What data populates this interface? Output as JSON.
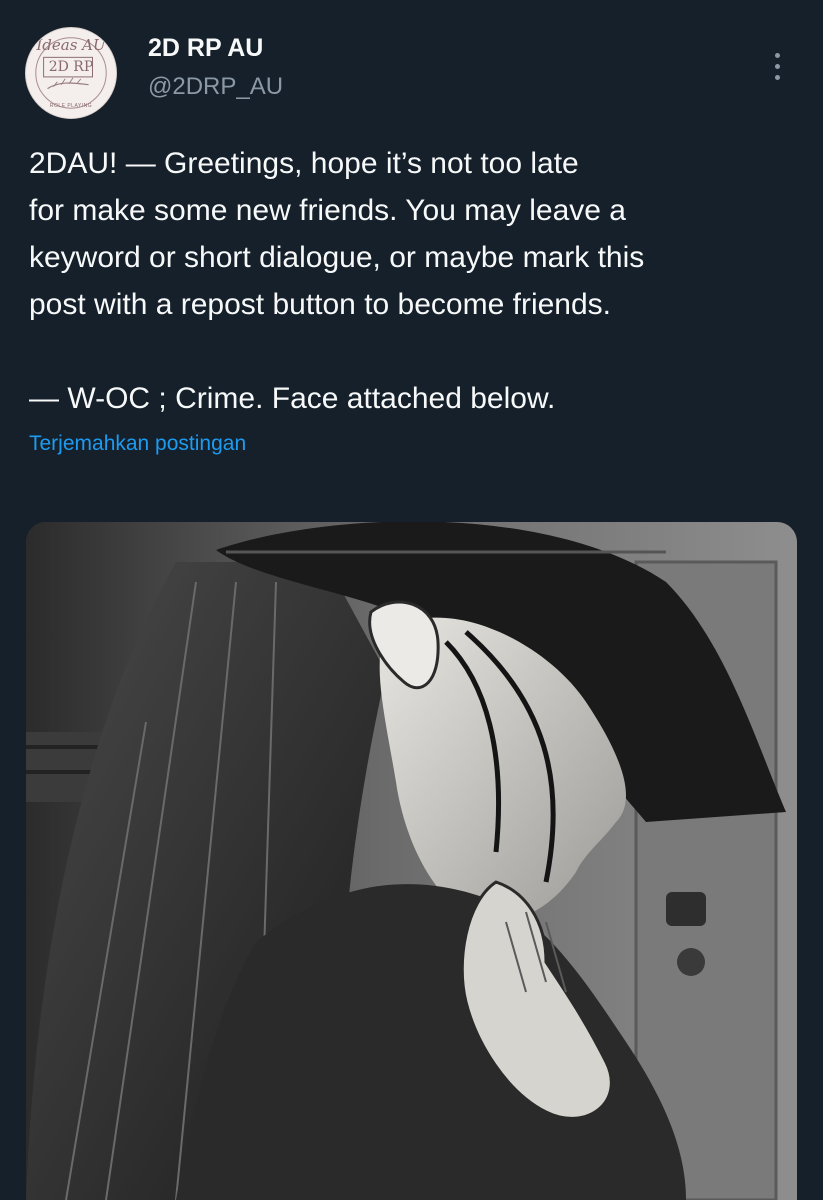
{
  "author": {
    "display_name": "2D RP AU",
    "handle": "@2DRP_AU",
    "avatar": {
      "logo_script": "Ideas AU",
      "logo_main": "2D RP",
      "logo_small": "ROLE PLAYING"
    }
  },
  "post": {
    "paragraph_1_lines": [
      "2DAU! — Greetings, hope it’s not too late",
      "for make some new friends. You may leave a",
      "keyword or short dialogue, or maybe mark this",
      "post with a repost button to become friends."
    ],
    "paragraph_2": "— W-OC ; Crime. Face attached below.",
    "translate_label": "Terjemahkan postingan"
  },
  "icons": {
    "more": "more-vertical-icon"
  },
  "colors": {
    "background": "#15202b",
    "text_primary": "#f7f9f9",
    "text_secondary": "#8b98a5",
    "link": "#1d9bf0"
  }
}
